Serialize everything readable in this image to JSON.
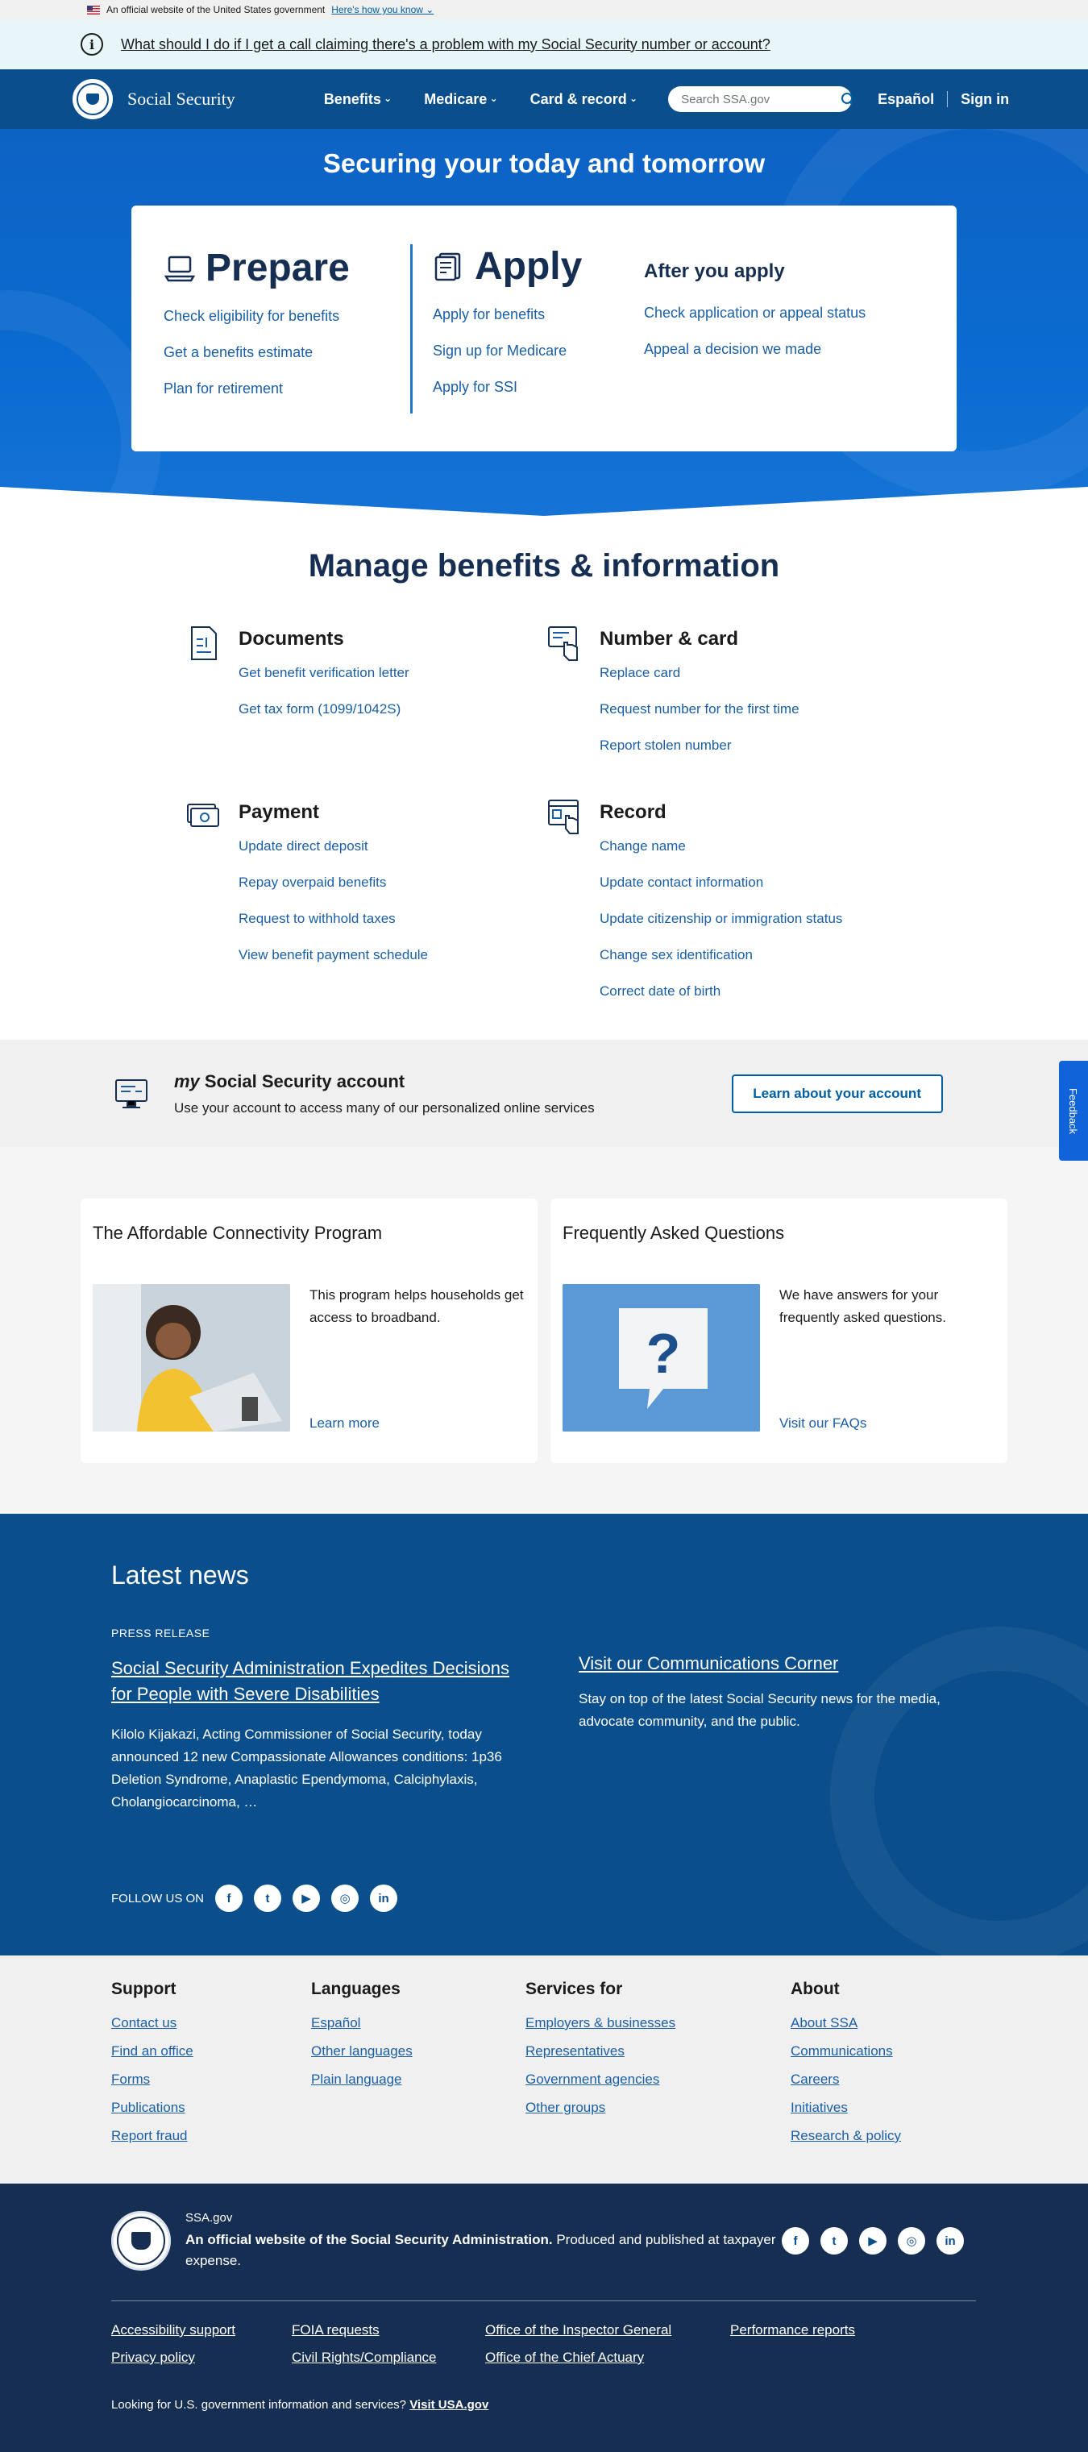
{
  "gov_banner": {
    "text": "An official website of the United States government",
    "link": "Here's how you know"
  },
  "alert": {
    "text": "What should I do if I get a call claiming there's a problem with my Social Security number or account?"
  },
  "header": {
    "brand": "Social Security",
    "nav": [
      "Benefits",
      "Medicare",
      "Card & record"
    ],
    "search_placeholder": "Search SSA.gov",
    "espanol": "Español",
    "signin": "Sign in"
  },
  "hero": {
    "title_a": "Securing your ",
    "title_b": "today",
    "title_c": " and ",
    "title_d": "tomorrow",
    "prepare": {
      "heading": "Prepare",
      "links": [
        "Check eligibility for benefits",
        "Get a benefits estimate",
        "Plan for retirement"
      ]
    },
    "apply": {
      "heading": "Apply",
      "links": [
        "Apply for benefits",
        "Sign up for Medicare",
        "Apply for SSI"
      ]
    },
    "after": {
      "heading": "After you apply",
      "links": [
        "Check application or appeal status",
        "Appeal a decision we made"
      ]
    }
  },
  "manage": {
    "title": "Manage benefits & information",
    "documents": {
      "heading": "Documents",
      "links": [
        "Get benefit verification letter",
        "Get tax form (1099/1042S)"
      ]
    },
    "number_card": {
      "heading": "Number & card",
      "links": [
        "Replace card",
        "Request number for the first time",
        "Report stolen number"
      ]
    },
    "payment": {
      "heading": "Payment",
      "links": [
        "Update direct deposit",
        "Repay overpaid benefits",
        "Request to withhold taxes",
        "View benefit payment schedule"
      ]
    },
    "record": {
      "heading": "Record",
      "links": [
        "Change name",
        "Update contact information",
        "Update citizenship or immigration status",
        "Change sex identification",
        "Correct date of birth"
      ]
    }
  },
  "account": {
    "my": "my",
    "title": " Social Security account",
    "desc": "Use your account to access many of our personalized online services",
    "button": "Learn about your account"
  },
  "feedback": "Feedback",
  "cards": [
    {
      "title": "The Affordable Connectivity Program",
      "desc": "This program helps households get access to broadband.",
      "link": "Learn more"
    },
    {
      "title": "Frequently Asked Questions",
      "desc": "We have answers for your frequently asked questions.",
      "link": "Visit our FAQs"
    }
  ],
  "news": {
    "title": "Latest news",
    "label": "PRESS RELEASE",
    "headline": "Social Security Administration Expedites Decisions for People with Severe Disabilities",
    "excerpt": "Kilolo Kijakazi, Acting Commissioner of Social Security, today announced 12 new Compassionate Allowances conditions: 1p36 Deletion Syndrome, Anaplastic Ependymoma, Calciphylaxis, Cholangiocarcinoma, …",
    "corner_link": "Visit our Communications Corner",
    "corner_desc": "Stay on top of the latest Social Security news for the media, advocate community, and the public.",
    "follow": "FOLLOW US ON"
  },
  "footer_cols": [
    {
      "heading": "Support",
      "links": [
        "Contact us",
        "Find an office",
        "Forms",
        "Publications",
        "Report fraud"
      ]
    },
    {
      "heading": "Languages",
      "links": [
        "Español",
        "Other languages",
        "Plain language"
      ]
    },
    {
      "heading": "Services for",
      "links": [
        "Employers & businesses",
        "Representatives",
        "Government agencies",
        "Other groups"
      ]
    },
    {
      "heading": "About",
      "links": [
        "About SSA",
        "Communications",
        "Careers",
        "Initiatives",
        "Research & policy"
      ]
    }
  ],
  "bottom": {
    "small": "SSA.gov",
    "bold": "An official website of the Social Security Administration.",
    "rest": " Produced and published at taxpayer expense.",
    "links": [
      "Accessibility support",
      "FOIA requests",
      "Office of the Inspector General",
      "Performance reports",
      "Privacy policy",
      "Civil Rights/Compliance",
      "Office of the Chief Actuary"
    ],
    "usa_text": "Looking for U.S. government information and services? ",
    "usa_link": "Visit USA.gov"
  }
}
